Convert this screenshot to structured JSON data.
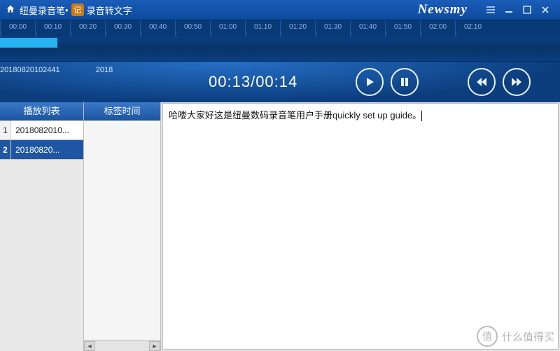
{
  "titlebar": {
    "app_name_1": "纽曼录音笔",
    "badge": "记",
    "app_name_2": "录音转文字",
    "brand": "Newsmy"
  },
  "timeline": {
    "ticks": [
      "00:00",
      "00:10",
      "00:20",
      "00:30",
      "00:40",
      "00:50",
      "01:00",
      "01:10",
      "01:20",
      "01:30",
      "01:40",
      "01:50",
      "02:00",
      "02:10"
    ]
  },
  "controls": {
    "file_label": "20180820102441",
    "year_label": "2018",
    "time_current": "00:13",
    "time_total": "00:14"
  },
  "panels": {
    "playlist_header": "播放列表",
    "bookmark_header": "标签时间"
  },
  "playlist": {
    "items": [
      {
        "index": "1",
        "name": "2018082010..."
      },
      {
        "index": "2",
        "name": "20180820..."
      }
    ],
    "active_index": 1
  },
  "transcript": {
    "text": "哈喽大家好这是纽曼数码录音笔用户手册quickly set up guide。"
  },
  "watermark": {
    "icon_text": "值",
    "text": "什么值得买"
  }
}
